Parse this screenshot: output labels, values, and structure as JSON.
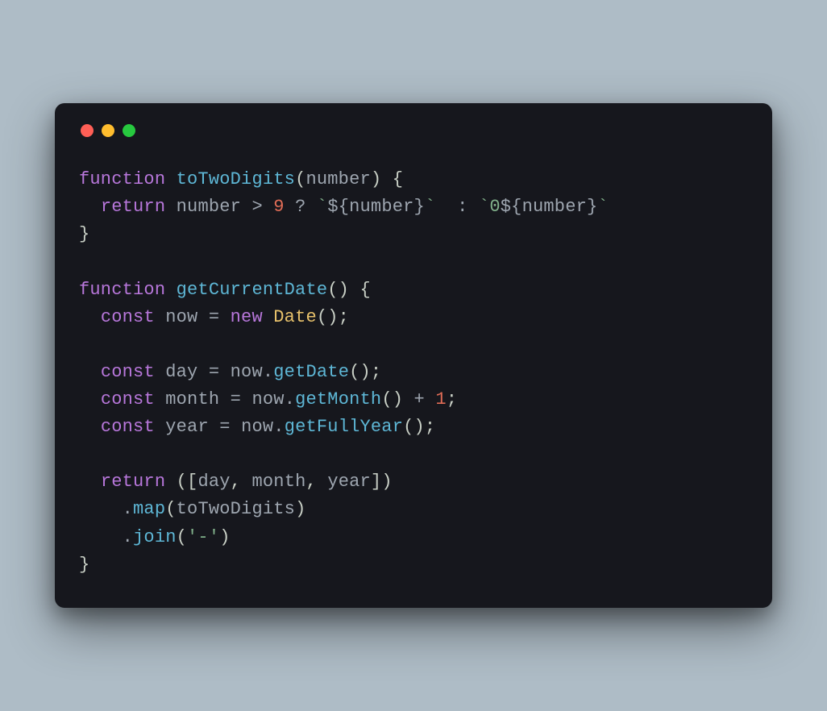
{
  "window": {
    "traffic_lights": [
      "close",
      "minimize",
      "zoom"
    ]
  },
  "code": {
    "tokens": [
      [
        {
          "t": "function ",
          "c": "kw"
        },
        {
          "t": "toTwoDigits",
          "c": "fn"
        },
        {
          "t": "(",
          "c": "pn"
        },
        {
          "t": "number",
          "c": "id"
        },
        {
          "t": ") {",
          "c": "pn"
        }
      ],
      [
        {
          "t": "  ",
          "c": "id"
        },
        {
          "t": "return ",
          "c": "kw"
        },
        {
          "t": "number ",
          "c": "id"
        },
        {
          "t": "> ",
          "c": "op"
        },
        {
          "t": "9",
          "c": "num"
        },
        {
          "t": " ? ",
          "c": "op"
        },
        {
          "t": "`",
          "c": "str"
        },
        {
          "t": "${",
          "c": "op"
        },
        {
          "t": "number",
          "c": "id"
        },
        {
          "t": "}",
          "c": "op"
        },
        {
          "t": "`",
          "c": "str"
        },
        {
          "t": "  : ",
          "c": "op"
        },
        {
          "t": "`0",
          "c": "str"
        },
        {
          "t": "${",
          "c": "op"
        },
        {
          "t": "number",
          "c": "id"
        },
        {
          "t": "}",
          "c": "op"
        },
        {
          "t": "`",
          "c": "str"
        }
      ],
      [
        {
          "t": "}",
          "c": "pn"
        }
      ],
      [
        {
          "t": "",
          "c": "id"
        }
      ],
      [
        {
          "t": "function ",
          "c": "kw"
        },
        {
          "t": "getCurrentDate",
          "c": "fn"
        },
        {
          "t": "() {",
          "c": "pn"
        }
      ],
      [
        {
          "t": "  ",
          "c": "id"
        },
        {
          "t": "const ",
          "c": "kw"
        },
        {
          "t": "now ",
          "c": "id"
        },
        {
          "t": "= ",
          "c": "op"
        },
        {
          "t": "new ",
          "c": "kw"
        },
        {
          "t": "Date",
          "c": "cls"
        },
        {
          "t": "();",
          "c": "pn"
        }
      ],
      [
        {
          "t": "",
          "c": "id"
        }
      ],
      [
        {
          "t": "  ",
          "c": "id"
        },
        {
          "t": "const ",
          "c": "kw"
        },
        {
          "t": "day ",
          "c": "id"
        },
        {
          "t": "= ",
          "c": "op"
        },
        {
          "t": "now",
          "c": "id"
        },
        {
          "t": ".",
          "c": "op"
        },
        {
          "t": "getDate",
          "c": "fn"
        },
        {
          "t": "();",
          "c": "pn"
        }
      ],
      [
        {
          "t": "  ",
          "c": "id"
        },
        {
          "t": "const ",
          "c": "kw"
        },
        {
          "t": "month ",
          "c": "id"
        },
        {
          "t": "= ",
          "c": "op"
        },
        {
          "t": "now",
          "c": "id"
        },
        {
          "t": ".",
          "c": "op"
        },
        {
          "t": "getMonth",
          "c": "fn"
        },
        {
          "t": "() ",
          "c": "pn"
        },
        {
          "t": "+ ",
          "c": "op"
        },
        {
          "t": "1",
          "c": "num"
        },
        {
          "t": ";",
          "c": "pn"
        }
      ],
      [
        {
          "t": "  ",
          "c": "id"
        },
        {
          "t": "const ",
          "c": "kw"
        },
        {
          "t": "year ",
          "c": "id"
        },
        {
          "t": "= ",
          "c": "op"
        },
        {
          "t": "now",
          "c": "id"
        },
        {
          "t": ".",
          "c": "op"
        },
        {
          "t": "getFullYear",
          "c": "fn"
        },
        {
          "t": "();",
          "c": "pn"
        }
      ],
      [
        {
          "t": "",
          "c": "id"
        }
      ],
      [
        {
          "t": "  ",
          "c": "id"
        },
        {
          "t": "return ",
          "c": "kw"
        },
        {
          "t": "([",
          "c": "pn"
        },
        {
          "t": "day",
          "c": "id"
        },
        {
          "t": ", ",
          "c": "pn"
        },
        {
          "t": "month",
          "c": "id"
        },
        {
          "t": ", ",
          "c": "pn"
        },
        {
          "t": "year",
          "c": "id"
        },
        {
          "t": "])",
          "c": "pn"
        }
      ],
      [
        {
          "t": "    .",
          "c": "op"
        },
        {
          "t": "map",
          "c": "fn"
        },
        {
          "t": "(",
          "c": "pn"
        },
        {
          "t": "toTwoDigits",
          "c": "id"
        },
        {
          "t": ")",
          "c": "pn"
        }
      ],
      [
        {
          "t": "    .",
          "c": "op"
        },
        {
          "t": "join",
          "c": "fn"
        },
        {
          "t": "(",
          "c": "pn"
        },
        {
          "t": "'-'",
          "c": "str"
        },
        {
          "t": ")",
          "c": "pn"
        }
      ],
      [
        {
          "t": "}",
          "c": "pn"
        }
      ]
    ]
  }
}
